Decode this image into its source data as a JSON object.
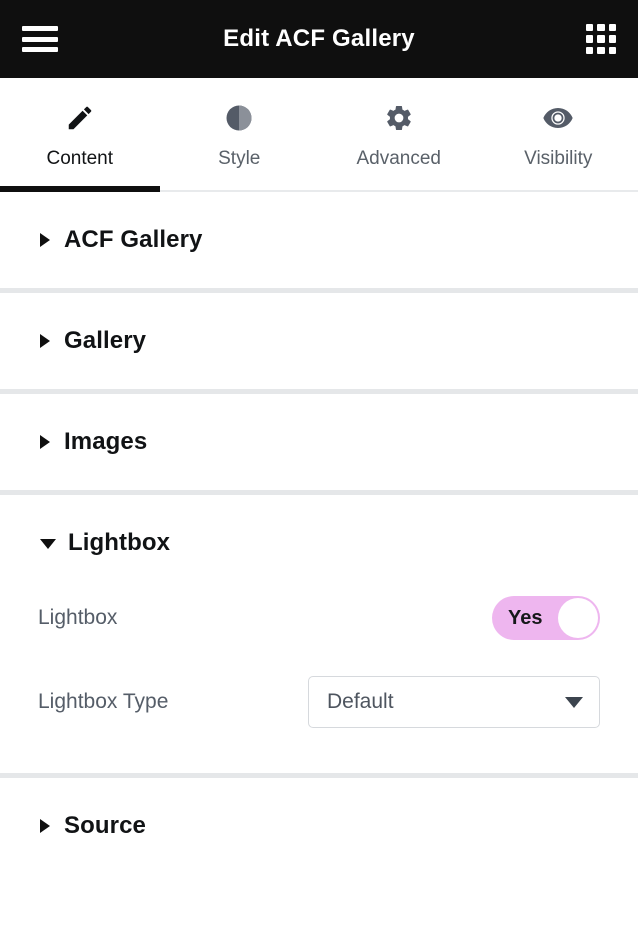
{
  "header": {
    "title": "Edit ACF Gallery",
    "menu_icon": "hamburger-menu-icon",
    "apps_icon": "grid-apps-icon"
  },
  "tabs": [
    {
      "label": "Content",
      "icon": "pencil-icon",
      "active": true
    },
    {
      "label": "Style",
      "icon": "contrast-circle-icon",
      "active": false
    },
    {
      "label": "Advanced",
      "icon": "gear-icon",
      "active": false
    },
    {
      "label": "Visibility",
      "icon": "eye-icon",
      "active": false
    }
  ],
  "sections": [
    {
      "title": "ACF Gallery",
      "expanded": false
    },
    {
      "title": "Gallery",
      "expanded": false
    },
    {
      "title": "Images",
      "expanded": false
    },
    {
      "title": "Lightbox",
      "expanded": true
    },
    {
      "title": "Source",
      "expanded": false
    }
  ],
  "lightbox": {
    "toggle": {
      "label": "Lightbox",
      "value": "Yes",
      "state": "on",
      "on_color": "#eeb6ef",
      "knob_color": "#ffffff"
    },
    "type": {
      "label": "Lightbox Type",
      "value": "Default",
      "caret_icon": "chevron-down-icon"
    }
  },
  "colors": {
    "header_bg": "#0f0f0f",
    "active_tab": "#111315",
    "inactive_tab": "#5a6169",
    "divider": "#e5e7e9",
    "accent": "#eeb6ef"
  }
}
